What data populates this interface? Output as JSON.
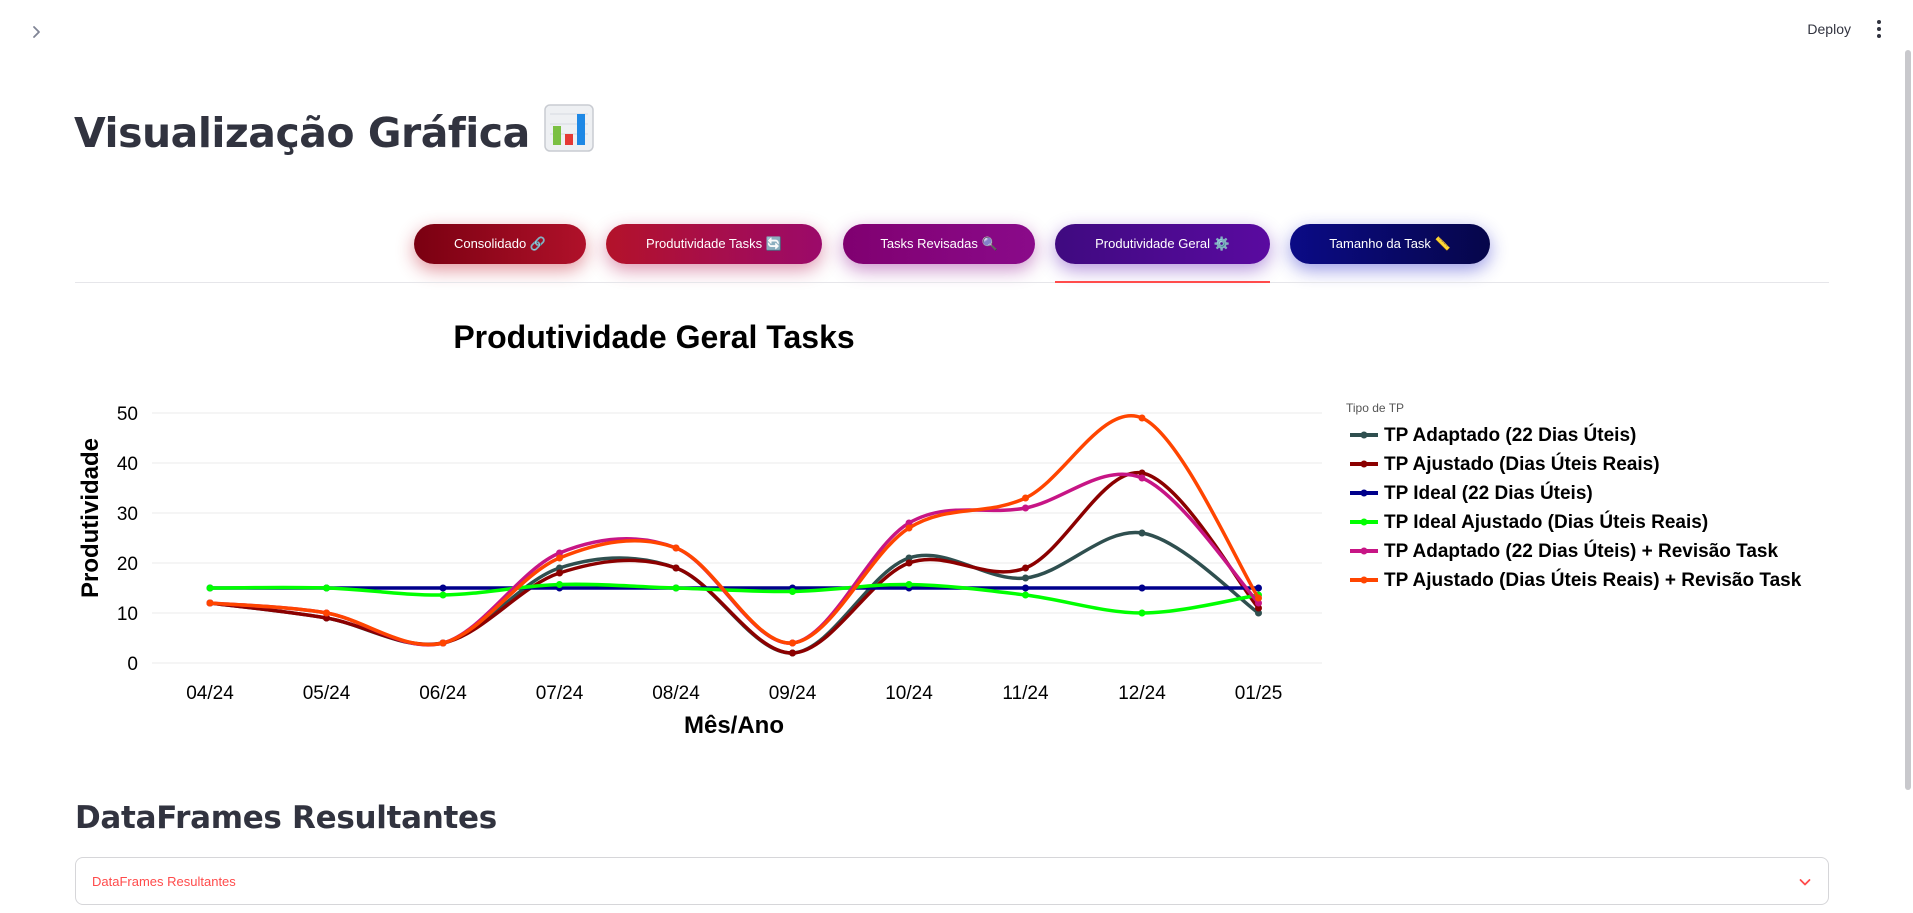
{
  "topbar": {
    "deploy_label": "Deploy"
  },
  "page": {
    "title": "Visualização Gráfica",
    "title_icon": "📊"
  },
  "tabs": [
    {
      "label": "Consolidado 🔗"
    },
    {
      "label": "Produtividade Tasks 🔄"
    },
    {
      "label": "Tasks Revisadas 🔍"
    },
    {
      "label": "Produtividade Geral ⚙️",
      "active": true
    },
    {
      "label": "Tamanho da Task 📏"
    }
  ],
  "chart_data": {
    "type": "line",
    "title": "Produtividade Geral Tasks",
    "xlabel": "Mês/Ano",
    "ylabel": "Produtividade",
    "legend_title": "Tipo de TP",
    "legend_position": "right",
    "grid": true,
    "ylim": [
      0,
      50
    ],
    "yticks": [
      0,
      10,
      20,
      30,
      40,
      50
    ],
    "categories": [
      "04/24",
      "05/24",
      "06/24",
      "07/24",
      "08/24",
      "09/24",
      "10/24",
      "11/24",
      "12/24",
      "01/25"
    ],
    "series": [
      {
        "name": "TP Adaptado (22 Dias Úteis)",
        "color": "#2f4f4f",
        "values": [
          12,
          9,
          4,
          19,
          19,
          2,
          21,
          17,
          26,
          10
        ]
      },
      {
        "name": "TP Ajustado (Dias Úteis Reais)",
        "color": "#8b0000",
        "values": [
          12,
          9,
          4,
          18,
          19,
          2,
          20,
          19,
          38,
          11
        ]
      },
      {
        "name": "TP Ideal (22 Dias Úteis)",
        "color": "#00008b",
        "values": [
          15,
          15,
          15,
          15,
          15,
          15,
          15,
          15,
          15,
          15
        ]
      },
      {
        "name": "TP Ideal Ajustado (Dias Úteis Reais)",
        "color": "#00ff00",
        "values": [
          15,
          15,
          13.6,
          15.7,
          15,
          14.3,
          15.7,
          13.6,
          10,
          13.6
        ]
      },
      {
        "name": "TP Adaptado (22 Dias Úteis) + Revisão Task",
        "color": "#c71585",
        "values": [
          12,
          10,
          4,
          22,
          23,
          4,
          28,
          31,
          37,
          12
        ]
      },
      {
        "name": "TP Ajustado (Dias Úteis Reais) + Revisão Task",
        "color": "#ff4500",
        "values": [
          12,
          10,
          4,
          21,
          23,
          4,
          27,
          33,
          49,
          13
        ]
      }
    ]
  },
  "section": {
    "title": "DataFrames Resultantes"
  },
  "expander": {
    "label": "DataFrames Resultantes"
  }
}
